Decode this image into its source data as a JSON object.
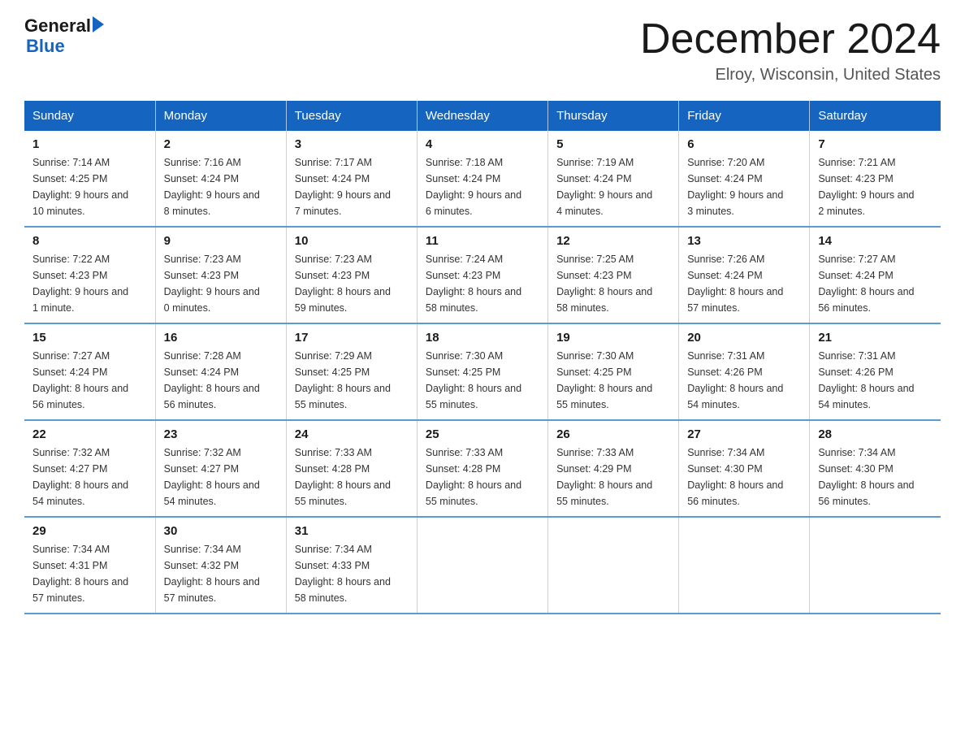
{
  "header": {
    "logo_line1": "General",
    "logo_line2": "Blue",
    "month_title": "December 2024",
    "location": "Elroy, Wisconsin, United States"
  },
  "weekdays": [
    "Sunday",
    "Monday",
    "Tuesday",
    "Wednesday",
    "Thursday",
    "Friday",
    "Saturday"
  ],
  "weeks": [
    [
      {
        "day": "1",
        "sunrise": "7:14 AM",
        "sunset": "4:25 PM",
        "daylight": "9 hours and 10 minutes."
      },
      {
        "day": "2",
        "sunrise": "7:16 AM",
        "sunset": "4:24 PM",
        "daylight": "9 hours and 8 minutes."
      },
      {
        "day": "3",
        "sunrise": "7:17 AM",
        "sunset": "4:24 PM",
        "daylight": "9 hours and 7 minutes."
      },
      {
        "day": "4",
        "sunrise": "7:18 AM",
        "sunset": "4:24 PM",
        "daylight": "9 hours and 6 minutes."
      },
      {
        "day": "5",
        "sunrise": "7:19 AM",
        "sunset": "4:24 PM",
        "daylight": "9 hours and 4 minutes."
      },
      {
        "day": "6",
        "sunrise": "7:20 AM",
        "sunset": "4:24 PM",
        "daylight": "9 hours and 3 minutes."
      },
      {
        "day": "7",
        "sunrise": "7:21 AM",
        "sunset": "4:23 PM",
        "daylight": "9 hours and 2 minutes."
      }
    ],
    [
      {
        "day": "8",
        "sunrise": "7:22 AM",
        "sunset": "4:23 PM",
        "daylight": "9 hours and 1 minute."
      },
      {
        "day": "9",
        "sunrise": "7:23 AM",
        "sunset": "4:23 PM",
        "daylight": "9 hours and 0 minutes."
      },
      {
        "day": "10",
        "sunrise": "7:23 AM",
        "sunset": "4:23 PM",
        "daylight": "8 hours and 59 minutes."
      },
      {
        "day": "11",
        "sunrise": "7:24 AM",
        "sunset": "4:23 PM",
        "daylight": "8 hours and 58 minutes."
      },
      {
        "day": "12",
        "sunrise": "7:25 AM",
        "sunset": "4:23 PM",
        "daylight": "8 hours and 58 minutes."
      },
      {
        "day": "13",
        "sunrise": "7:26 AM",
        "sunset": "4:24 PM",
        "daylight": "8 hours and 57 minutes."
      },
      {
        "day": "14",
        "sunrise": "7:27 AM",
        "sunset": "4:24 PM",
        "daylight": "8 hours and 56 minutes."
      }
    ],
    [
      {
        "day": "15",
        "sunrise": "7:27 AM",
        "sunset": "4:24 PM",
        "daylight": "8 hours and 56 minutes."
      },
      {
        "day": "16",
        "sunrise": "7:28 AM",
        "sunset": "4:24 PM",
        "daylight": "8 hours and 56 minutes."
      },
      {
        "day": "17",
        "sunrise": "7:29 AM",
        "sunset": "4:25 PM",
        "daylight": "8 hours and 55 minutes."
      },
      {
        "day": "18",
        "sunrise": "7:30 AM",
        "sunset": "4:25 PM",
        "daylight": "8 hours and 55 minutes."
      },
      {
        "day": "19",
        "sunrise": "7:30 AM",
        "sunset": "4:25 PM",
        "daylight": "8 hours and 55 minutes."
      },
      {
        "day": "20",
        "sunrise": "7:31 AM",
        "sunset": "4:26 PM",
        "daylight": "8 hours and 54 minutes."
      },
      {
        "day": "21",
        "sunrise": "7:31 AM",
        "sunset": "4:26 PM",
        "daylight": "8 hours and 54 minutes."
      }
    ],
    [
      {
        "day": "22",
        "sunrise": "7:32 AM",
        "sunset": "4:27 PM",
        "daylight": "8 hours and 54 minutes."
      },
      {
        "day": "23",
        "sunrise": "7:32 AM",
        "sunset": "4:27 PM",
        "daylight": "8 hours and 54 minutes."
      },
      {
        "day": "24",
        "sunrise": "7:33 AM",
        "sunset": "4:28 PM",
        "daylight": "8 hours and 55 minutes."
      },
      {
        "day": "25",
        "sunrise": "7:33 AM",
        "sunset": "4:28 PM",
        "daylight": "8 hours and 55 minutes."
      },
      {
        "day": "26",
        "sunrise": "7:33 AM",
        "sunset": "4:29 PM",
        "daylight": "8 hours and 55 minutes."
      },
      {
        "day": "27",
        "sunrise": "7:34 AM",
        "sunset": "4:30 PM",
        "daylight": "8 hours and 56 minutes."
      },
      {
        "day": "28",
        "sunrise": "7:34 AM",
        "sunset": "4:30 PM",
        "daylight": "8 hours and 56 minutes."
      }
    ],
    [
      {
        "day": "29",
        "sunrise": "7:34 AM",
        "sunset": "4:31 PM",
        "daylight": "8 hours and 57 minutes."
      },
      {
        "day": "30",
        "sunrise": "7:34 AM",
        "sunset": "4:32 PM",
        "daylight": "8 hours and 57 minutes."
      },
      {
        "day": "31",
        "sunrise": "7:34 AM",
        "sunset": "4:33 PM",
        "daylight": "8 hours and 58 minutes."
      },
      null,
      null,
      null,
      null
    ]
  ],
  "labels": {
    "sunrise": "Sunrise:",
    "sunset": "Sunset:",
    "daylight": "Daylight:"
  }
}
